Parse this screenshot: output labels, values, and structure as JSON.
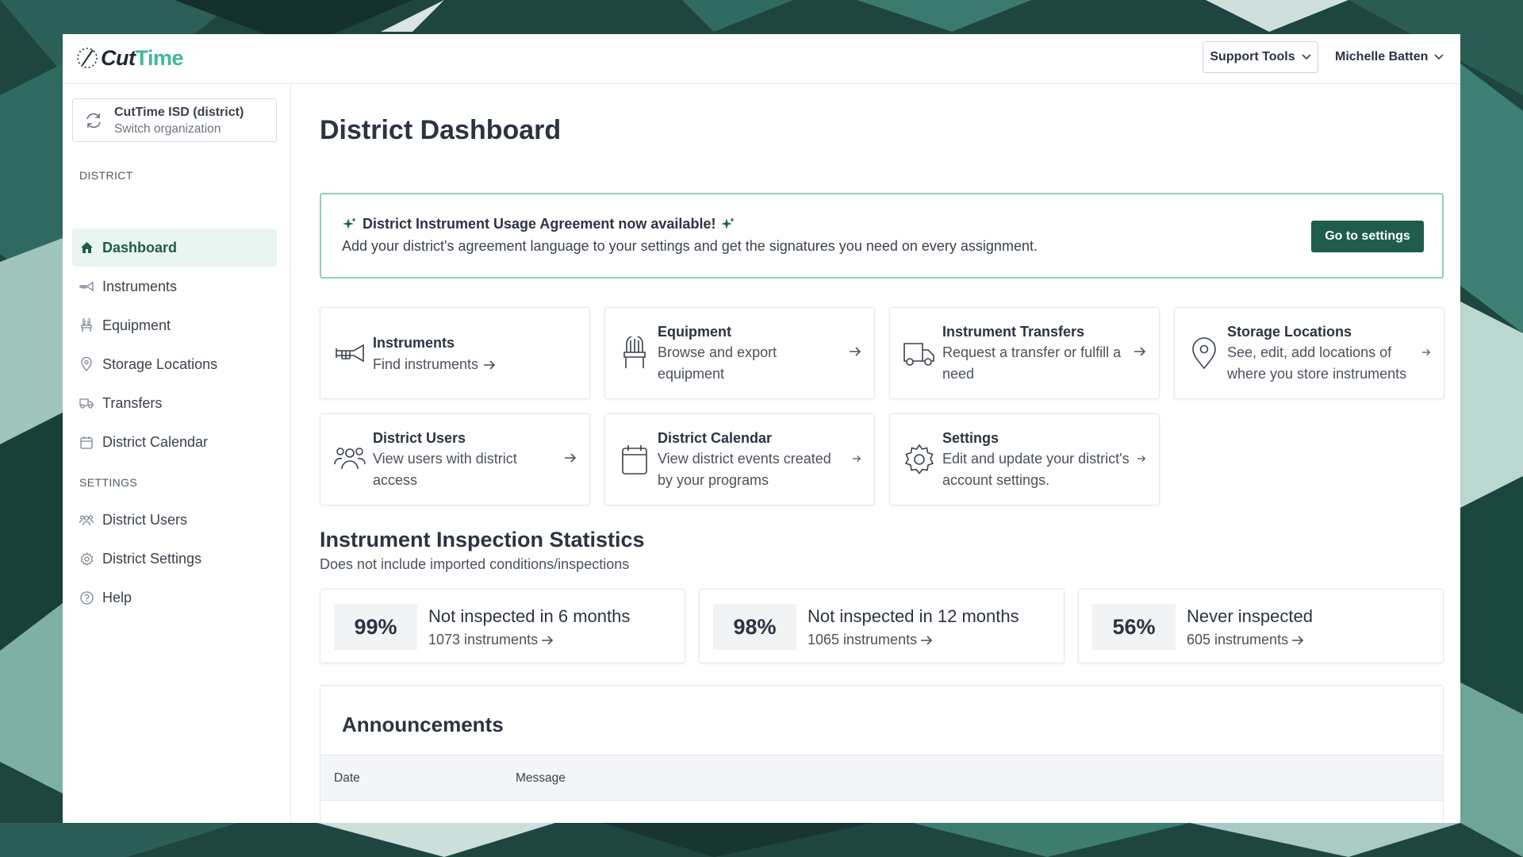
{
  "app": {
    "logo_cut": "Cut",
    "logo_time": "Time",
    "support_tools_label": "Support Tools",
    "user_name": "Michelle Batten"
  },
  "sidebar": {
    "org_name": "CutTime ISD (district)",
    "org_action": "Switch organization",
    "section_district": "DISTRICT",
    "section_settings": "SETTINGS",
    "district_items": [
      {
        "label": "Dashboard",
        "icon": "home-icon",
        "active": true
      },
      {
        "label": "Instruments",
        "icon": "trumpet-icon"
      },
      {
        "label": "Equipment",
        "icon": "chair-icon"
      },
      {
        "label": "Storage Locations",
        "icon": "map-pin-icon"
      },
      {
        "label": "Transfers",
        "icon": "truck-icon"
      },
      {
        "label": "District Calendar",
        "icon": "calendar-icon"
      }
    ],
    "settings_items": [
      {
        "label": "District Users",
        "icon": "users-icon"
      },
      {
        "label": "District Settings",
        "icon": "gear-icon"
      },
      {
        "label": "Help",
        "icon": "help-circle-icon"
      }
    ]
  },
  "main": {
    "title": "District Dashboard",
    "banner": {
      "title": "District Instrument Usage Agreement now available!",
      "text": "Add your district's agreement language to your settings and get the signatures you need on every assignment.",
      "button": "Go to settings"
    },
    "cards": [
      {
        "title": "Instruments",
        "desc": "Find instruments",
        "icon": "trumpet-icon"
      },
      {
        "title": "Equipment",
        "desc": "Browse and export equipment",
        "icon": "chair-icon"
      },
      {
        "title": "Instrument Transfers",
        "desc": "Request a transfer or fulfill a need",
        "icon": "truck-icon"
      },
      {
        "title": "Storage Locations",
        "desc": "See, edit, add locations of where you store instruments",
        "icon": "map-pin-icon"
      },
      {
        "title": "District Users",
        "desc": "View users with district access",
        "icon": "users-icon"
      },
      {
        "title": "District Calendar",
        "desc": "View district events created by your programs",
        "icon": "calendar-icon"
      },
      {
        "title": "Settings",
        "desc": "Edit and update your district's account settings.",
        "icon": "gear-icon"
      }
    ],
    "stats": {
      "title": "Instrument Inspection Statistics",
      "subtitle": "Does not include imported conditions/inspections",
      "items": [
        {
          "pct": "99%",
          "label": "Not inspected in 6 months",
          "count": "1073 instruments"
        },
        {
          "pct": "98%",
          "label": "Not inspected in 12 months",
          "count": "1065 instruments"
        },
        {
          "pct": "56%",
          "label": "Never inspected",
          "count": "605 instruments"
        }
      ]
    },
    "announcements": {
      "title": "Announcements",
      "col_date": "Date",
      "col_message": "Message"
    }
  },
  "colors": {
    "brand_dark": "#1f5c4d",
    "brand_light": "#3fb89a",
    "banner_border": "#8fcfbe",
    "active_bg": "#eaf4f1"
  }
}
